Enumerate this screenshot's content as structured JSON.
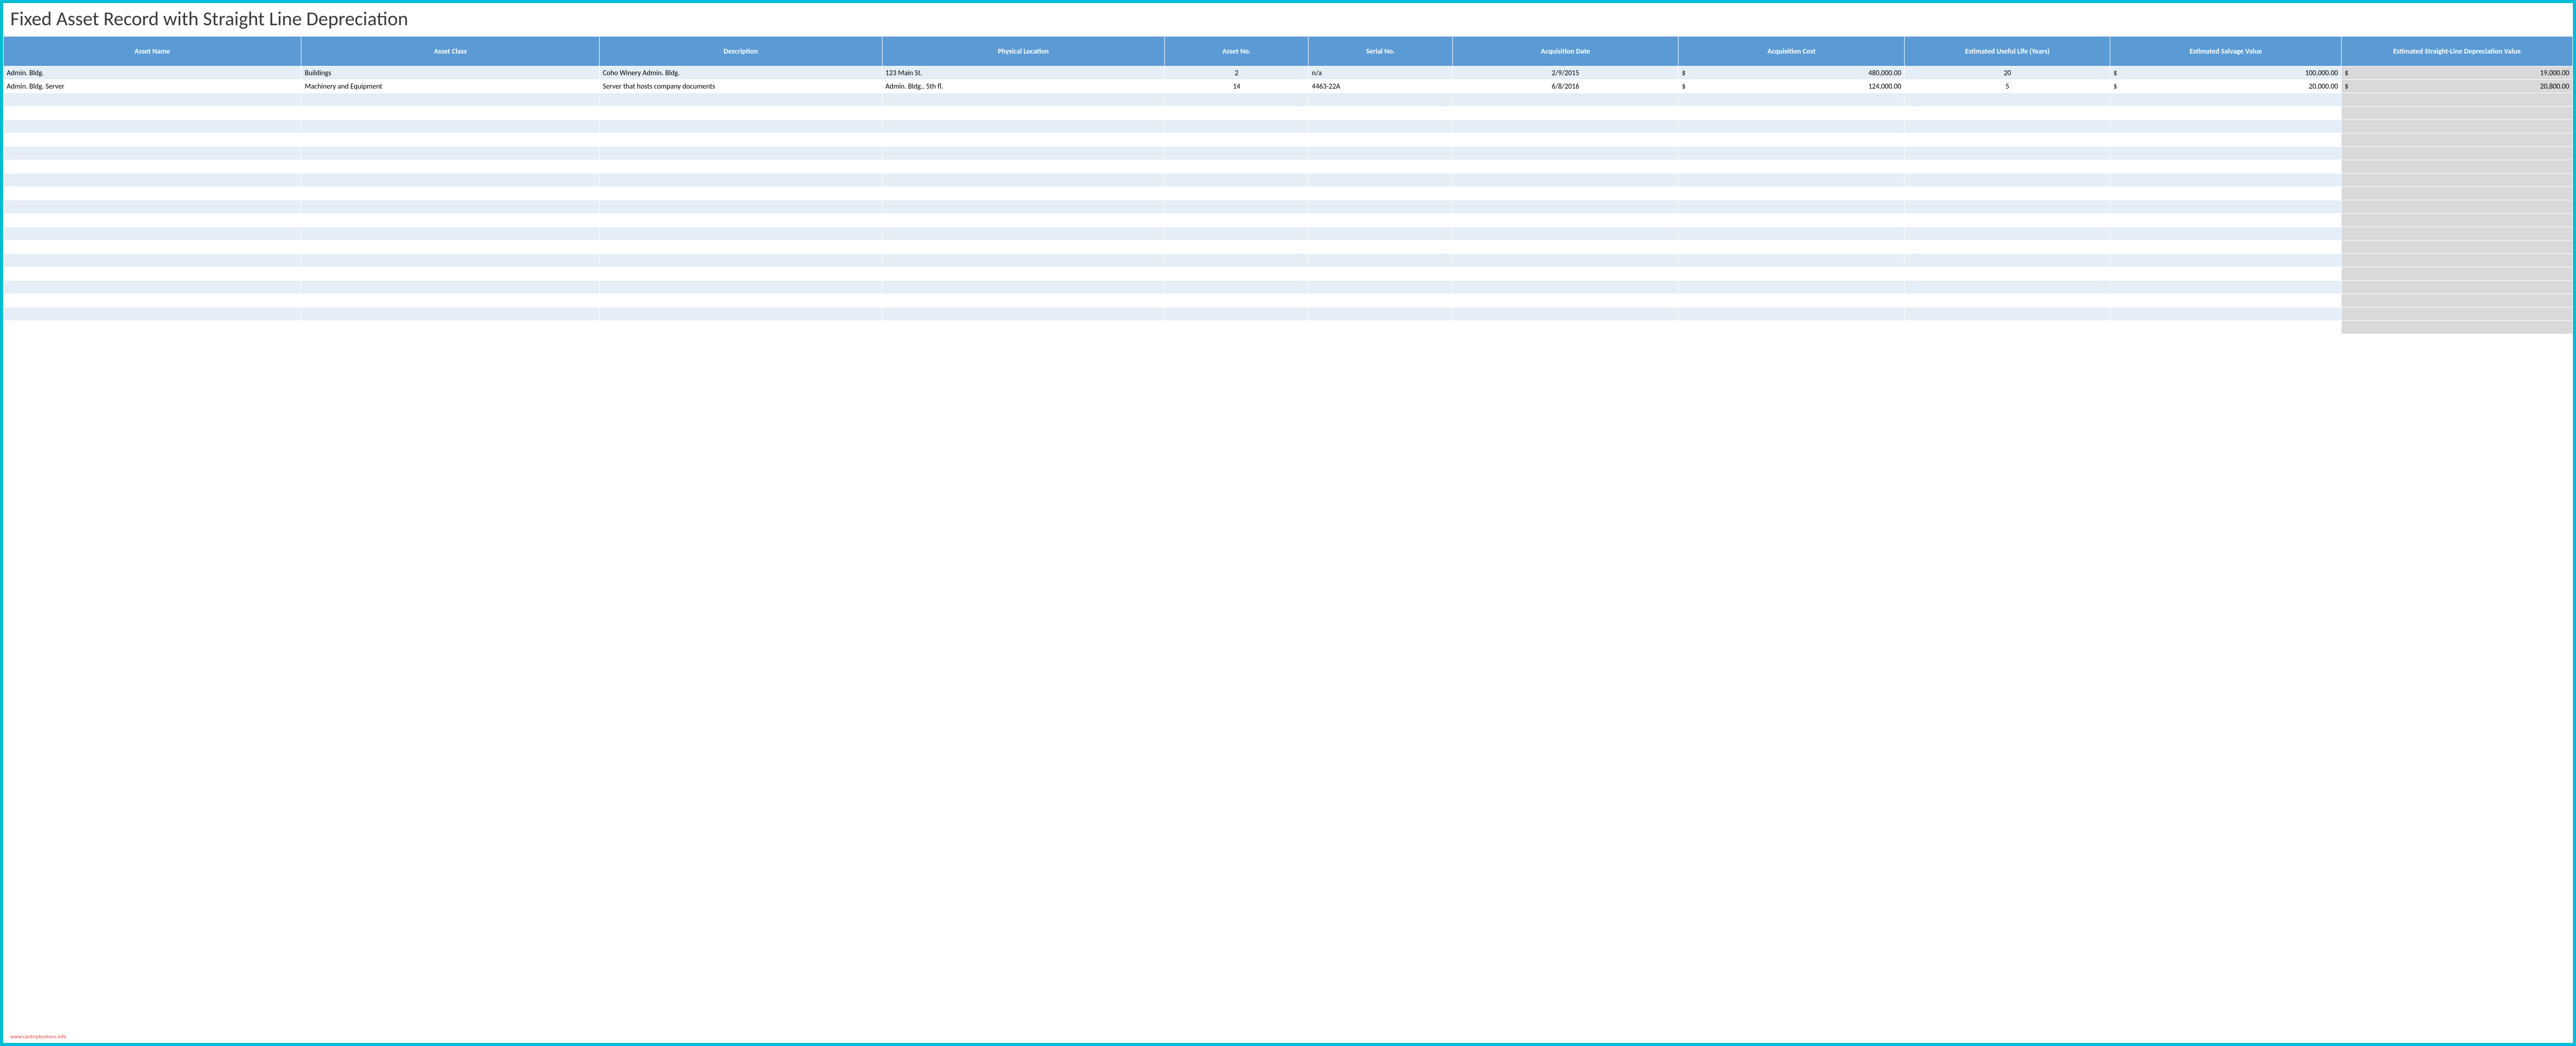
{
  "title": "Fixed Asset Record with Straight Line Depreciation",
  "watermark": "www.cantripbostons.info",
  "columns": [
    "Asset Name",
    "Asset Class",
    "Description",
    "Physical Location",
    "Asset No.",
    "Serial No.",
    "Acquisition Date",
    "Acquisition Cost",
    "Estimated Useful Life (Years)",
    "Estimated Salvage Value",
    "Estimated Straight-Line Depreciation Value"
  ],
  "rows": [
    {
      "asset_name": "Admin. Bldg.",
      "asset_class": "Buildings",
      "description": "Coho Winery Admin. Bldg.",
      "location": "123 Main St.",
      "asset_no": "2",
      "serial_no": "n/a",
      "acq_date": "2/9/2015",
      "acq_cost_cur": "$",
      "acq_cost": "480,000.00",
      "life": "20",
      "salvage_cur": "$",
      "salvage": "100,000.00",
      "dep_cur": "$",
      "dep": "19,000.00"
    },
    {
      "asset_name": "Admin. Bldg. Server",
      "asset_class": "Machinery and Equipment",
      "description": "Server that hosts company documents",
      "location": "Admin. Bldg., 5th fl.",
      "asset_no": "14",
      "serial_no": "4463-22A",
      "acq_date": "6/8/2016",
      "acq_cost_cur": "$",
      "acq_cost": "124,000.00",
      "life": "5",
      "salvage_cur": "$",
      "salvage": "20,000.00",
      "dep_cur": "$",
      "dep": "20,800.00"
    }
  ],
  "empty_row_count": 18
}
